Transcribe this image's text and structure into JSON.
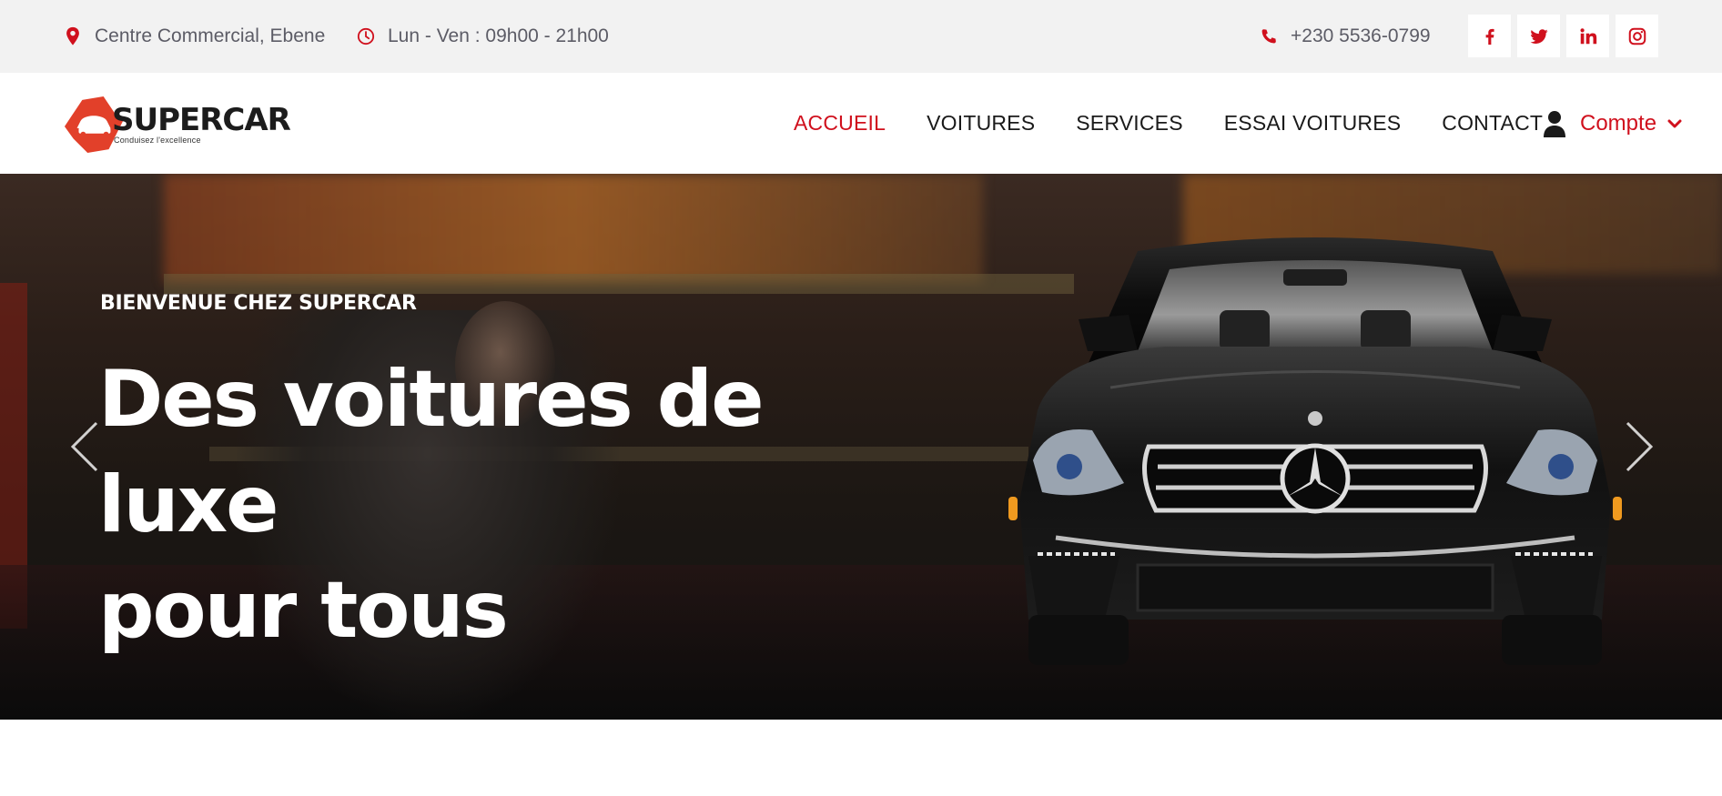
{
  "topbar": {
    "location": "Centre Commercial, Ebene",
    "hours": "Lun - Ven : 09h00 - 21h00",
    "phone": "+230 5536-0799",
    "socials": [
      "facebook-icon",
      "twitter-icon",
      "linkedin-icon",
      "instagram-icon"
    ]
  },
  "brand": {
    "name": "SUPERCAR",
    "tagline": "Conduisez l'excellence"
  },
  "nav": {
    "links": [
      "ACCUEIL",
      "VOITURES",
      "SERVICES",
      "ESSAI VOITURES",
      "CONTACT"
    ],
    "active": "ACCUEIL",
    "account_label": "Compte"
  },
  "hero": {
    "subtitle": "BIENVENUE CHEZ SUPERCAR",
    "title_line1": "Des voitures de luxe",
    "title_line2": "pour tous"
  },
  "colors": {
    "accent": "#d0101d",
    "topbar_bg": "#f2f2f2",
    "text_dark": "#1a1a1a",
    "text_muted": "#5c5c66"
  }
}
